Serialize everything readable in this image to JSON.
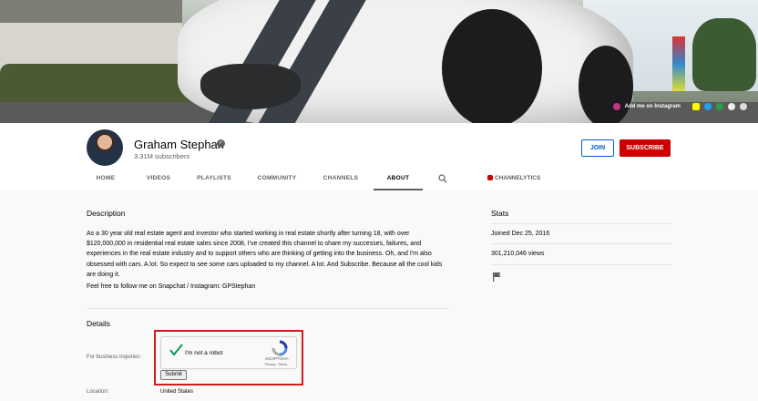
{
  "banner": {
    "instagram_label": "Add me on Instagram",
    "icons": [
      "instagram-icon",
      "snapchat-icon",
      "link-icon",
      "link-icon",
      "link-icon",
      "link-icon"
    ]
  },
  "channel": {
    "name": "Graham Stephan",
    "subscribers": "3.31M subscribers",
    "join_label": "JOIN",
    "subscribe_label": "SUBSCRIBE"
  },
  "tabs": [
    "HOME",
    "VIDEOS",
    "PLAYLISTS",
    "COMMUNITY",
    "CHANNELS",
    "ABOUT"
  ],
  "active_tab": "ABOUT",
  "extension_tab": "CHANNELYTICS",
  "description": {
    "title": "Description",
    "body": "As a 30 year old real estate agent and investor who started working in real estate shortly after turning 18, with over $120,000,000 in residential real estate sales since 2008, I've created this channel to share my successes, failures, and experiences in the real estate industry and to support others who are thinking of getting into the business. Oh, and I'm also obsessed with cars. A lot. So expect to see some cars uploaded to my channel. A lot. And Subscribe. Because all the cool kids are doing it.",
    "follow": "Feel free to follow me on Snapchat / Instagram: GPStephan"
  },
  "details": {
    "title": "Details",
    "business_label": "For business inquiries:",
    "captcha_label": "I'm not a robot",
    "captcha_brand": "reCAPTCHA",
    "captcha_links": "Privacy - Terms",
    "submit_label": "Submit",
    "location_label": "Location:",
    "location_value": "United States"
  },
  "stats": {
    "title": "Stats",
    "joined": "Joined Dec 25, 2016",
    "views": "301,210,046 views"
  },
  "colors": {
    "subscribe": "#cc0000",
    "join": "#065fd4",
    "highlight": "#d41a1a",
    "check": "#009e55"
  }
}
